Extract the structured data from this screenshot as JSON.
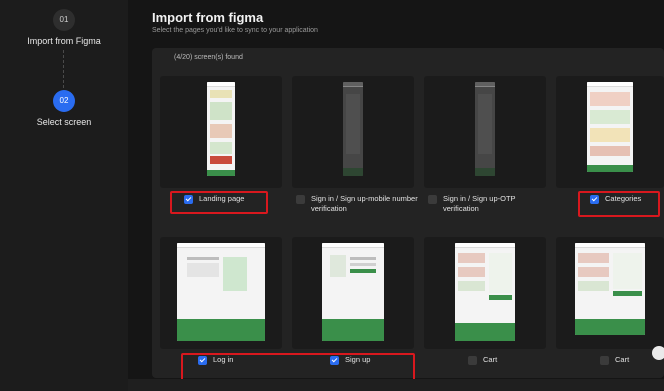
{
  "steps": [
    {
      "number": "01",
      "label": "Import from Figma",
      "state": "done"
    },
    {
      "number": "02",
      "label": "Select screen",
      "state": "active"
    }
  ],
  "header": {
    "title": "Import from figma",
    "subtitle": "Select the pages you'd like to sync to your application"
  },
  "found_text": "(4/20) screen(s) found",
  "screens": [
    {
      "label": "Landing page",
      "checked": true,
      "highlighted": true
    },
    {
      "label": "Sign in / Sign up-mobile number verification",
      "checked": false,
      "highlighted": false
    },
    {
      "label": "Sign in / Sign up-OTP verification",
      "checked": false,
      "highlighted": false
    },
    {
      "label": "Categories",
      "checked": true,
      "highlighted": true
    },
    {
      "label": "Log in",
      "checked": true,
      "highlighted": true
    },
    {
      "label": "Sign up",
      "checked": true,
      "highlighted": true
    },
    {
      "label": "Cart",
      "checked": false,
      "highlighted": false
    },
    {
      "label": "Cart",
      "checked": false,
      "highlighted": false
    }
  ],
  "colors": {
    "accent": "#2a6cf0",
    "highlight": "#d8181e",
    "brand_green": "#3a8f4a"
  }
}
